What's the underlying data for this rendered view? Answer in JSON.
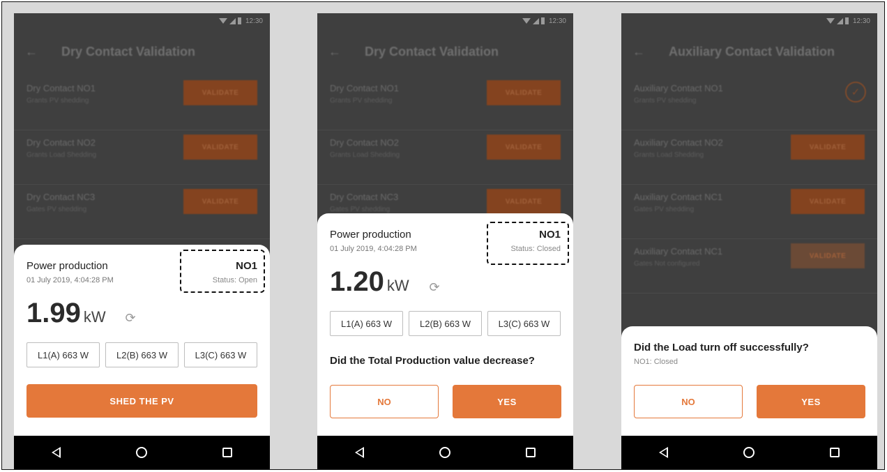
{
  "screens": [
    {
      "app_title": "Dry Contact Validation",
      "rows": [
        {
          "title": "Dry Contact NO1",
          "sub": "Grants PV shedding",
          "action": "VALIDATE"
        },
        {
          "title": "Dry Contact NO2",
          "sub": "Grants Load Shedding",
          "action": "VALIDATE"
        },
        {
          "title": "Dry Contact NC3",
          "sub": "Gates PV shedding",
          "action": "VALIDATE"
        }
      ],
      "sheet": {
        "title": "Power production",
        "date": "01 July 2019, 4:04:28 PM",
        "contact_id": "NO1",
        "status": "Status: Open",
        "power_value": "1.99",
        "power_unit": "kW",
        "phases": [
          "L1(A) 663 W",
          "L2(B) 663 W",
          "L3(C) 663 W"
        ],
        "primary_button": "SHED THE PV"
      }
    },
    {
      "app_title": "Dry Contact Validation",
      "rows": [
        {
          "title": "Dry Contact NO1",
          "sub": "Grants PV shedding",
          "action": "VALIDATE"
        },
        {
          "title": "Dry Contact NO2",
          "sub": "Grants Load Shedding",
          "action": "VALIDATE"
        },
        {
          "title": "Dry Contact NC3",
          "sub": "Gates PV shedding",
          "action": "VALIDATE"
        }
      ],
      "sheet": {
        "title": "Power production",
        "date": "01 July 2019, 4:04:28 PM",
        "contact_id": "NO1",
        "status": "Status: Closed",
        "power_value": "1.20",
        "power_unit": "kW",
        "phases": [
          "L1(A) 663 W",
          "L2(B) 663 W",
          "L3(C) 663 W"
        ],
        "question": "Did the Total Production value decrease?",
        "no_label": "NO",
        "yes_label": "YES"
      }
    },
    {
      "app_title": "Auxiliary Contact Validation",
      "rows": [
        {
          "title": "Auxiliary Contact NO1",
          "sub": "Grants PV shedding",
          "action": ""
        },
        {
          "title": "Auxiliary Contact NO2",
          "sub": "Grants Load Shedding",
          "action": "VALIDATE"
        },
        {
          "title": "Auxiliary Contact NC1",
          "sub": "Gates PV shedding",
          "action": "VALIDATE"
        },
        {
          "title": "Auxiliary Contact NC1",
          "sub": "Gates Not configured",
          "action": "VALIDATE"
        }
      ],
      "sheet": {
        "question": "Did the Load turn off successfully?",
        "sub": "NO1: Closed",
        "no_label": "NO",
        "yes_label": "YES"
      }
    }
  ],
  "status_time": "12:30",
  "accent_color": "#e4783a",
  "icons": [
    "back-arrow-icon",
    "refresh-icon",
    "check-circle-icon",
    "nav-back-icon",
    "nav-home-icon",
    "nav-recent-icon",
    "wifi-icon",
    "signal-icon",
    "battery-icon"
  ]
}
